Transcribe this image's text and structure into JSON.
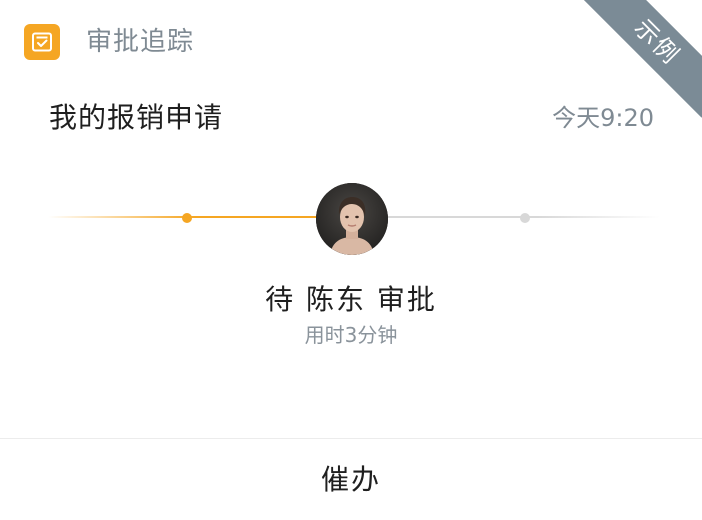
{
  "header": {
    "icon": "approval-doc-icon",
    "title": "审批追踪"
  },
  "ribbon": {
    "label": "示例"
  },
  "request": {
    "subject": "我的报销申请",
    "time": "今天9:20"
  },
  "progress": {
    "steps_total": 3,
    "current_step": 2,
    "status": "待 陈东 审批",
    "duration": "用时3分钟"
  },
  "actions": {
    "urge_label": "催办"
  },
  "colors": {
    "accent": "#f5a623",
    "ribbon": "#7b8b96",
    "muted_text": "#7f8a93",
    "track_inactive": "#d8d8d8"
  }
}
